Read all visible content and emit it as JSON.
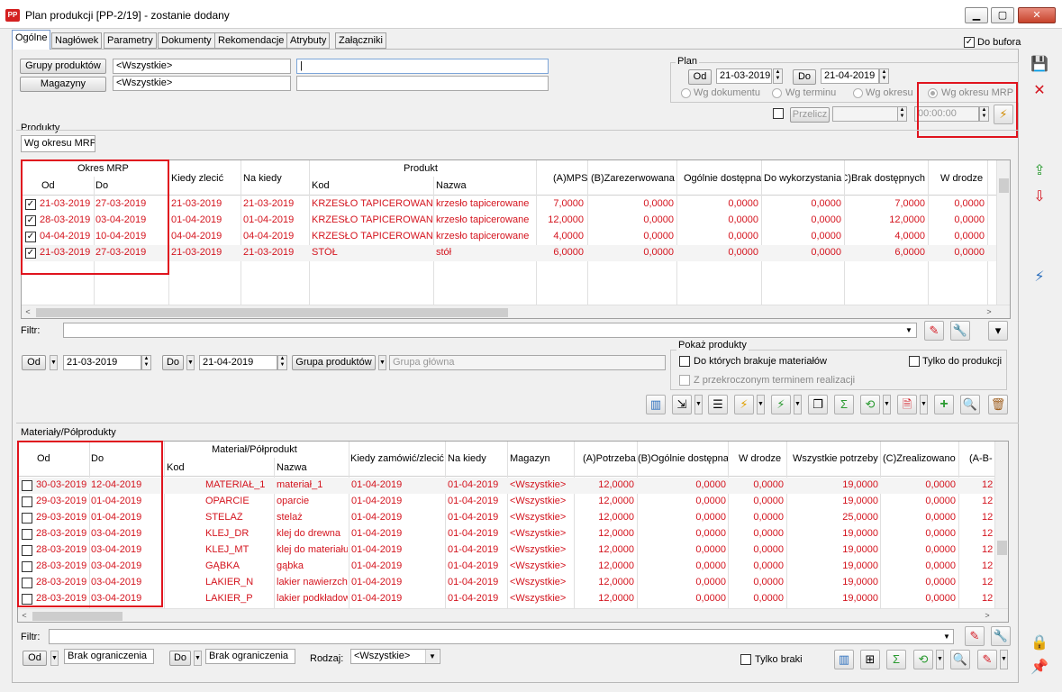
{
  "window": {
    "title": "Plan produkcji [PP-2/19] - zostanie dodany",
    "app_icon": "PP",
    "minimize": "▁",
    "maximize": "▢",
    "close": "✕"
  },
  "tabs": [
    "Ogólne",
    "Nagłówek",
    "Parametry",
    "Dokumenty",
    "Rekomendacje",
    "Atrybuty",
    "Załączniki"
  ],
  "do_bufora": "Do bufora",
  "filters": {
    "grupy_produktow_label": "Grupy produktów",
    "grupy_produktow_value": "<Wszystkie>",
    "magazyny_label": "Magazyny",
    "magazyny_value": "<Wszystkie>"
  },
  "plan": {
    "label": "Plan",
    "od_label": "Od",
    "od_value": "21-03-2019",
    "do_label": "Do",
    "do_value": "21-04-2019",
    "radio_dokumentu": "Wg dokumentu",
    "radio_terminu": "Wg terminu",
    "radio_okresu": "Wg okresu",
    "radio_okresu_mrp": "Wg okresu MRP",
    "przelicz": "Przelicz",
    "time_value": "00:00:00"
  },
  "produkty": {
    "section_label": "Produkty",
    "mode_tab": "Wg okresu MRP",
    "headers": {
      "okres_mrp": "Okres MRP",
      "od": "Od",
      "do": "Do",
      "kiedy_zlecic": "Kiedy zlecić",
      "na_kiedy": "Na kiedy",
      "produkt": "Produkt",
      "kod": "Kod",
      "nazwa": "Nazwa",
      "mps": "(A)MPS",
      "zarezerwowana": "(B)Zarezerwowana",
      "ogolnie_dostepna": "Ogólnie dostępna",
      "do_wykorzystania": "Do wykorzystania",
      "brak_dostepnych": "(C)Brak dostępnych",
      "w_drodze": "W drodze"
    },
    "rows": [
      {
        "od": "21-03-2019",
        "do": "27-03-2019",
        "kiedy": "21-03-2019",
        "na_kiedy": "21-03-2019",
        "kod": "KRZESŁO TAPICEROWANE",
        "nazwa": "krzesło tapicerowane",
        "mps": "7,0000",
        "zar": "0,0000",
        "ogol": "0,0000",
        "dowyk": "0,0000",
        "brak": "7,0000",
        "wdrodze": "0,0000"
      },
      {
        "od": "28-03-2019",
        "do": "03-04-2019",
        "kiedy": "01-04-2019",
        "na_kiedy": "01-04-2019",
        "kod": "KRZESŁO TAPICEROWANE",
        "nazwa": "krzesło tapicerowane",
        "mps": "12,0000",
        "zar": "0,0000",
        "ogol": "0,0000",
        "dowyk": "0,0000",
        "brak": "12,0000",
        "wdrodze": "0,0000"
      },
      {
        "od": "04-04-2019",
        "do": "10-04-2019",
        "kiedy": "04-04-2019",
        "na_kiedy": "04-04-2019",
        "kod": "KRZESŁO TAPICEROWANE",
        "nazwa": "krzesło tapicerowane",
        "mps": "4,0000",
        "zar": "0,0000",
        "ogol": "0,0000",
        "dowyk": "0,0000",
        "brak": "4,0000",
        "wdrodze": "0,0000"
      },
      {
        "od": "21-03-2019",
        "do": "27-03-2019",
        "kiedy": "21-03-2019",
        "na_kiedy": "21-03-2019",
        "kod": "STÓŁ",
        "nazwa": "stół",
        "mps": "6,0000",
        "zar": "0,0000",
        "ogol": "0,0000",
        "dowyk": "0,0000",
        "brak": "6,0000",
        "wdrodze": "0,0000"
      }
    ],
    "filtr_label": "Filtr:",
    "od_btn": "Od",
    "od_value": "21-03-2019",
    "do_btn": "Do",
    "do_value": "21-04-2019",
    "grupa_produktow_btn": "Grupa produktów",
    "grupa_placeholder": "Grupa główna",
    "pokaz_produkty": "Pokaż produkty",
    "brakuje_materialow": "Do których brakuje materiałów",
    "tylko_do_produkcji": "Tylko do produkcji",
    "przekroczonym_terminem": "Z przekroczonym terminem realizacji"
  },
  "materialy": {
    "section_label": "Materiały/Półprodukty",
    "headers": {
      "od": "Od",
      "do": "Do",
      "material": "Materiał/Półprodukt",
      "kod": "Kod",
      "nazwa": "Nazwa",
      "kiedy_zamowic": "Kiedy zamówić/zlecić",
      "na_kiedy": "Na kiedy",
      "magazyn": "Magazyn",
      "potrzeba": "(A)Potrzeba",
      "ogolnie_dostepna": "(B)Ogólnie dostępna",
      "w_drodze": "W drodze",
      "wszystkie_potrzeby": "Wszystkie potrzeby",
      "zrealizowano": "(C)Zrealizowano",
      "abc": "(A-B-"
    },
    "rows": [
      {
        "od": "30-03-2019",
        "do": "12-04-2019",
        "kod": "MATERIAŁ_1",
        "nazwa": "materiał_1",
        "kiedy": "01-04-2019",
        "na_kiedy": "01-04-2019",
        "mag": "<Wszystkie>",
        "potrz": "12,0000",
        "ogol": "0,0000",
        "wdr": "0,0000",
        "wsz": "19,0000",
        "zreal": "0,0000",
        "abc": "12"
      },
      {
        "od": "29-03-2019",
        "do": "01-04-2019",
        "kod": "OPARCIE",
        "nazwa": "oparcie",
        "kiedy": "01-04-2019",
        "na_kiedy": "01-04-2019",
        "mag": "<Wszystkie>",
        "potrz": "12,0000",
        "ogol": "0,0000",
        "wdr": "0,0000",
        "wsz": "19,0000",
        "zreal": "0,0000",
        "abc": "12"
      },
      {
        "od": "29-03-2019",
        "do": "01-04-2019",
        "kod": "STELAŻ",
        "nazwa": "stelaż",
        "kiedy": "01-04-2019",
        "na_kiedy": "01-04-2019",
        "mag": "<Wszystkie>",
        "potrz": "12,0000",
        "ogol": "0,0000",
        "wdr": "0,0000",
        "wsz": "25,0000",
        "zreal": "0,0000",
        "abc": "12"
      },
      {
        "od": "28-03-2019",
        "do": "03-04-2019",
        "kod": "KLEJ_DR",
        "nazwa": "klej do drewna",
        "kiedy": "01-04-2019",
        "na_kiedy": "01-04-2019",
        "mag": "<Wszystkie>",
        "potrz": "12,0000",
        "ogol": "0,0000",
        "wdr": "0,0000",
        "wsz": "19,0000",
        "zreal": "0,0000",
        "abc": "12"
      },
      {
        "od": "28-03-2019",
        "do": "03-04-2019",
        "kod": "KLEJ_MT",
        "nazwa": "klej do materiału",
        "kiedy": "01-04-2019",
        "na_kiedy": "01-04-2019",
        "mag": "<Wszystkie>",
        "potrz": "12,0000",
        "ogol": "0,0000",
        "wdr": "0,0000",
        "wsz": "19,0000",
        "zreal": "0,0000",
        "abc": "12"
      },
      {
        "od": "28-03-2019",
        "do": "03-04-2019",
        "kod": "GĄBKA",
        "nazwa": "gąbka",
        "kiedy": "01-04-2019",
        "na_kiedy": "01-04-2019",
        "mag": "<Wszystkie>",
        "potrz": "12,0000",
        "ogol": "0,0000",
        "wdr": "0,0000",
        "wsz": "19,0000",
        "zreal": "0,0000",
        "abc": "12"
      },
      {
        "od": "28-03-2019",
        "do": "03-04-2019",
        "kod": "LAKIER_N",
        "nazwa": "lakier nawierzchniowy",
        "kiedy": "01-04-2019",
        "na_kiedy": "01-04-2019",
        "mag": "<Wszystkie>",
        "potrz": "12,0000",
        "ogol": "0,0000",
        "wdr": "0,0000",
        "wsz": "19,0000",
        "zreal": "0,0000",
        "abc": "12"
      },
      {
        "od": "28-03-2019",
        "do": "03-04-2019",
        "kod": "LAKIER_P",
        "nazwa": "lakier podkładowy",
        "kiedy": "01-04-2019",
        "na_kiedy": "01-04-2019",
        "mag": "<Wszystkie>",
        "potrz": "12,0000",
        "ogol": "0,0000",
        "wdr": "0,0000",
        "wsz": "19,0000",
        "zreal": "0,0000",
        "abc": "12"
      }
    ],
    "filtr_label": "Filtr:",
    "od_btn": "Od",
    "od_value": "Brak ograniczenia",
    "do_btn": "Do",
    "do_value": "Brak ograniczenia",
    "rodzaj_label": "Rodzaj:",
    "rodzaj_value": "<Wszystkie>",
    "tylko_braki": "Tylko braki"
  },
  "colors": {
    "accent_red": "#e0141e",
    "data_red": "#d4141e",
    "selection_blue": "#7ca5d8"
  }
}
